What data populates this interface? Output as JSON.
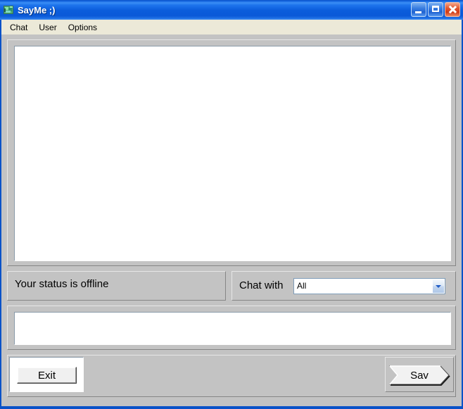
{
  "window": {
    "title": "SayMe ;)",
    "app_icon": "saymi-app-icon",
    "controls": {
      "minimize": "minimize-icon",
      "maximize": "maximize-icon",
      "close": "close-icon"
    }
  },
  "menubar": {
    "items": [
      {
        "label": "Chat"
      },
      {
        "label": "User"
      },
      {
        "label": "Options"
      }
    ]
  },
  "chat": {
    "history_text": "",
    "message_input_value": ""
  },
  "status": {
    "text": "Your status is offline"
  },
  "chat_with": {
    "label": "Chat with",
    "selected": "All",
    "options": [
      "All"
    ],
    "arrow_icon": "chevron-down-icon"
  },
  "buttons": {
    "exit_label": "Exit",
    "save_label": "Sav"
  },
  "colors": {
    "titlebar_blue": "#0a52c8",
    "menubar": "#ece9d8",
    "client_gray": "#c3c3c3",
    "field_white": "#ffffff",
    "combo_border": "#7f9db9",
    "close_red": "#cf3b18"
  }
}
